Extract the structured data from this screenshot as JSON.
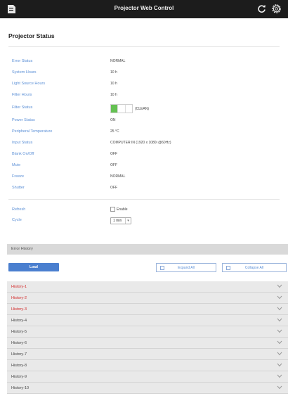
{
  "header": {
    "title": "Projector Web Control",
    "menu_icon": "document-menu-icon",
    "refresh_icon": "refresh-icon",
    "settings_icon": "gear-icon"
  },
  "page_title": "Projector Status",
  "status": [
    {
      "label": "Error Status",
      "value": "NORMAL"
    },
    {
      "label": "System Hours",
      "value": "10 h"
    },
    {
      "label": "Light Source Hours",
      "value": "10 h"
    },
    {
      "label": "Filter Hours",
      "value": "10 h"
    },
    {
      "label": "Filter Status",
      "value": "(CLEAN)"
    },
    {
      "label": "Power Status",
      "value": "ON"
    },
    {
      "label": "Peripheral Temperature",
      "value": "25 °C"
    },
    {
      "label": "Input Status",
      "value": "COMPUTER IN   (1920 x 1080i @60Hz)"
    },
    {
      "label": "Blank On/Off",
      "value": "OFF"
    },
    {
      "label": "Mute",
      "value": "OFF"
    },
    {
      "label": "Freeze",
      "value": "NORMAL"
    },
    {
      "label": "Shutter",
      "value": "OFF"
    }
  ],
  "filter_level": {
    "filled": 1,
    "total": 3
  },
  "refresh": {
    "label": "Refresh",
    "checkbox_label": "Enable",
    "checked": false
  },
  "cycle": {
    "label": "Cycle",
    "value": "1 min"
  },
  "error_history": {
    "title": "Error History",
    "load_label": "Load",
    "expand_label": "Expand All",
    "collapse_label": "Collapse All",
    "items": [
      {
        "label": "History-1",
        "error": true
      },
      {
        "label": "History-2",
        "error": true
      },
      {
        "label": "History-3",
        "error": true
      },
      {
        "label": "History-4",
        "error": false
      },
      {
        "label": "History-5",
        "error": false
      },
      {
        "label": "History-6",
        "error": false
      },
      {
        "label": "History-7",
        "error": false
      },
      {
        "label": "History-8",
        "error": false
      },
      {
        "label": "History-9",
        "error": false
      },
      {
        "label": "History-10",
        "error": false
      }
    ]
  },
  "colors": {
    "label_blue": "#5b8fd6",
    "error_red": "#d42a2a",
    "filter_green": "#64c152",
    "button_blue": "#4a7fcf",
    "topbar": "#1c1c1c"
  }
}
